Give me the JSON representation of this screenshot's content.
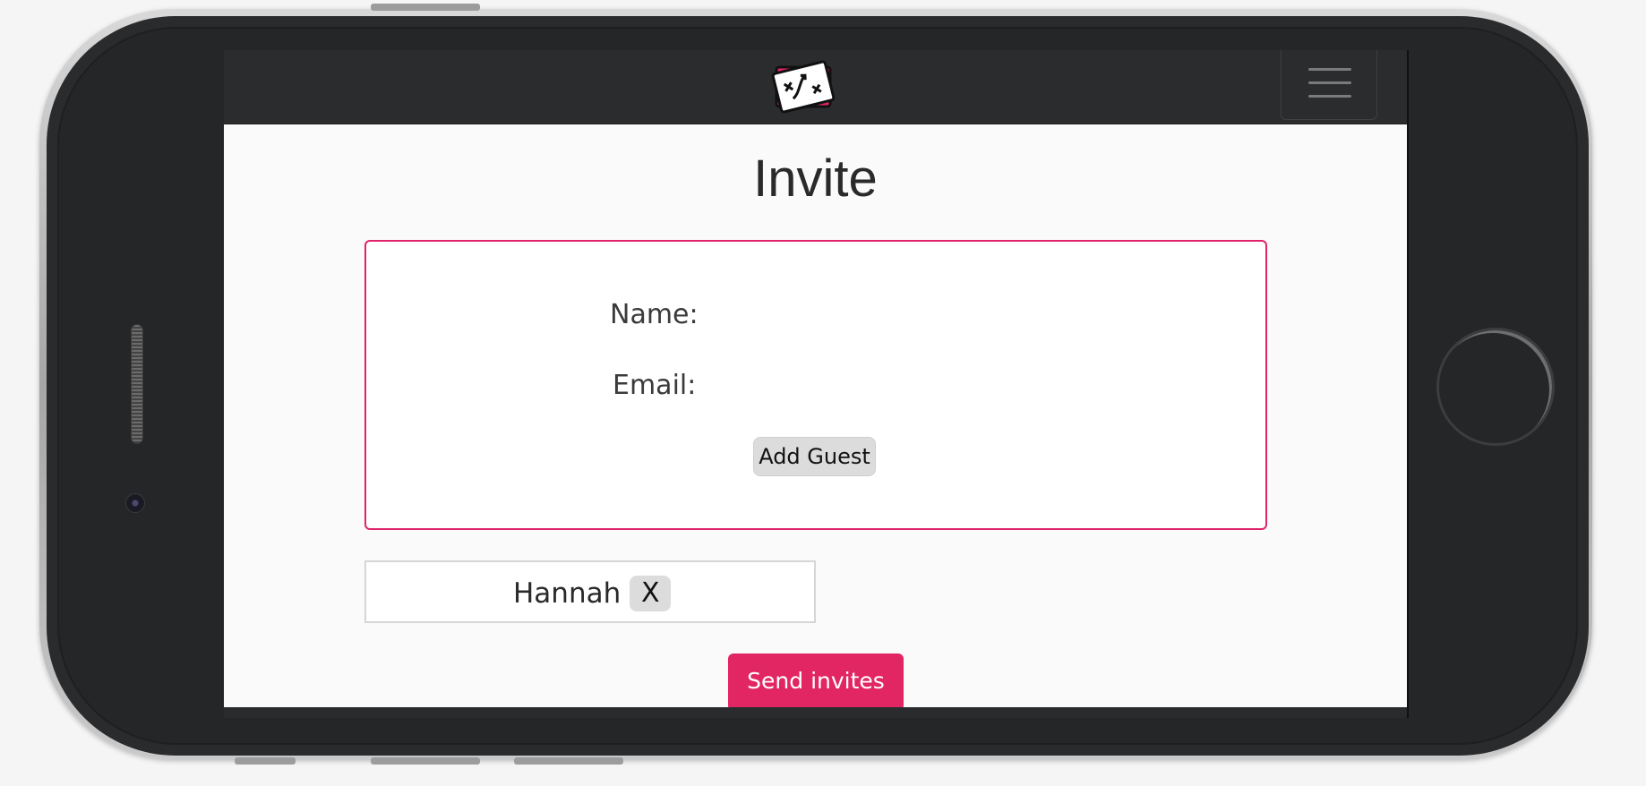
{
  "app": {
    "logo_icon": "playbook-card-logo-icon",
    "menu_icon": "hamburger-menu-icon"
  },
  "page": {
    "title": "Invite"
  },
  "form": {
    "name_label": "Name:",
    "email_label": "Email:",
    "name_value": "",
    "email_value": "",
    "add_guest_label": "Add Guest"
  },
  "guests": [
    {
      "name": "Hannah",
      "remove_label": "X"
    }
  ],
  "actions": {
    "send_label": "Send invites"
  },
  "colors": {
    "accent": "#e22563",
    "navbar": "#2b2c2e",
    "page_bg": "#fafafa"
  }
}
